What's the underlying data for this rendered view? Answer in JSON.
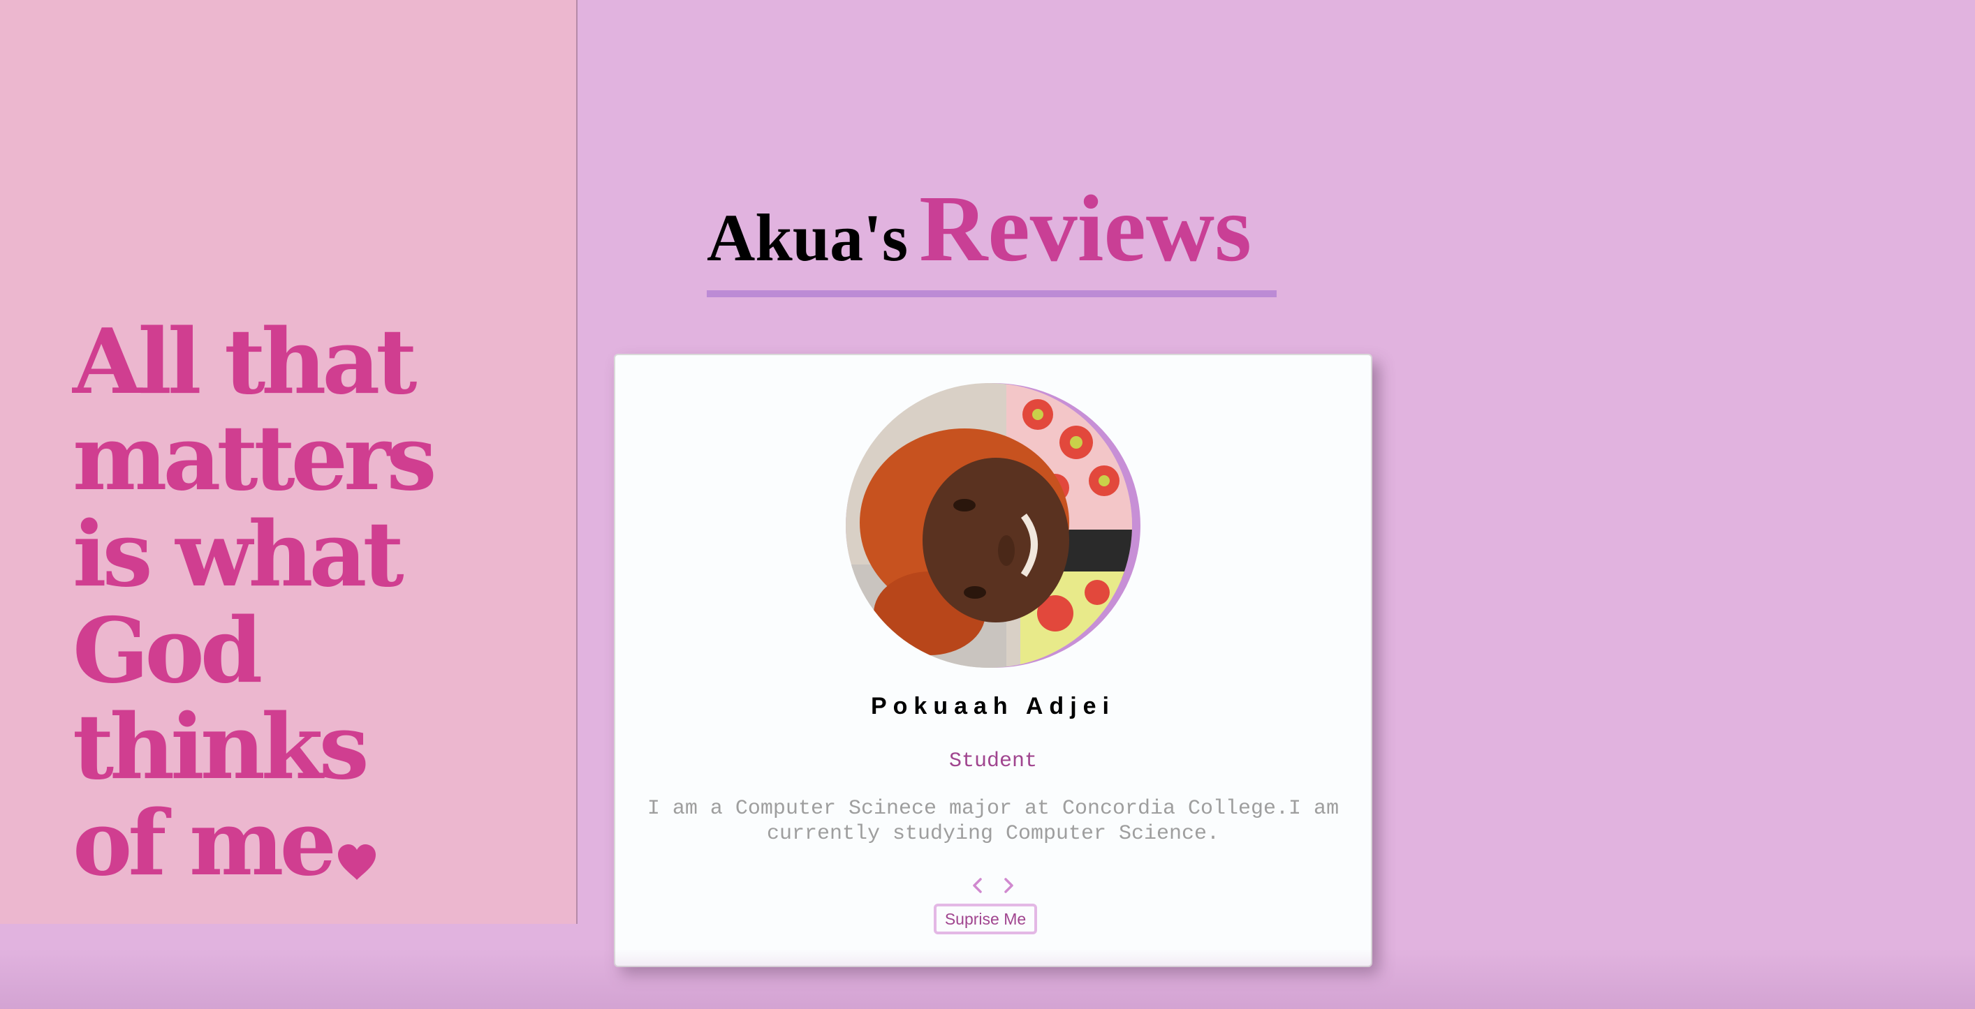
{
  "quote_panel": {
    "lines": [
      "All that",
      "matters",
      "is what",
      "God",
      "thinks",
      "of me"
    ],
    "accent_color": "#d03e90",
    "background_color": "#ecb7cf",
    "end_icon": "heart-icon"
  },
  "header": {
    "owner": "Akua's",
    "title": "Reviews",
    "title_color": "#c93f95",
    "underline_color": "#bc8bd5"
  },
  "review": {
    "name": "Pokuaah Adjei",
    "role": "Student",
    "text": "I am a Computer Scinece major at Concordia College.I am currently studying Computer Science.",
    "avatar_icon": "person-photo"
  },
  "controls": {
    "prev_icon": "chevron-left-icon",
    "next_icon": "chevron-right-icon",
    "surprise_label": "Suprise Me"
  },
  "colors": {
    "page_background": "#e1b3df",
    "card_background": "#fbfdfe"
  }
}
